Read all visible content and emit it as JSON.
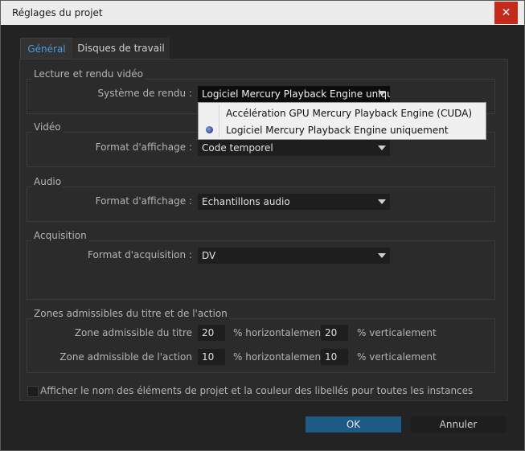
{
  "window": {
    "title": "Réglages du projet",
    "close_glyph": "✕"
  },
  "tabs": [
    {
      "label": "Général",
      "active": true
    },
    {
      "label": "Disques de travail",
      "active": false
    }
  ],
  "playback": {
    "group_title": "Lecture et rendu vidéo",
    "renderer_label": "Système de rendu :",
    "renderer_value": "Logiciel Mercury Playback Engine uniquem",
    "options": [
      "Accélération GPU Mercury Playback Engine (CUDA)",
      "Logiciel Mercury Playback Engine uniquement"
    ],
    "selected_index": 1
  },
  "video": {
    "group_title": "Vidéo",
    "display_label": "Format d'affichage :",
    "display_value": "Code temporel"
  },
  "audio": {
    "group_title": "Audio",
    "display_label": "Format d'affichage :",
    "display_value": "Echantillons audio"
  },
  "capture": {
    "group_title": "Acquisition",
    "format_label": "Format d'acquisition :",
    "format_value": "DV"
  },
  "safe_zones": {
    "group_title": "Zones admissibles du titre et de l'action",
    "title_label": "Zone admissible du titre",
    "title_h": "20",
    "title_v": "20",
    "action_label": "Zone admissible de l'action",
    "action_h": "10",
    "action_v": "10",
    "h_unit": "% horizontalement",
    "v_unit": "% verticalement"
  },
  "show_names": {
    "label": "Afficher le nom des éléments de projet et la couleur des libellés pour toutes les instances",
    "checked": false
  },
  "buttons": {
    "ok": "OK",
    "cancel": "Annuler"
  },
  "colors": {
    "accent": "#4a9ae0",
    "ok_button": "#1d5a86",
    "close_button": "#c42b1c"
  }
}
